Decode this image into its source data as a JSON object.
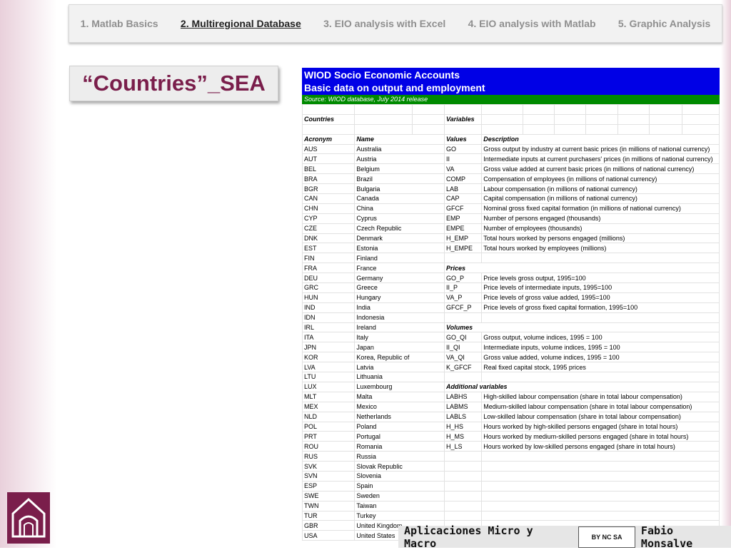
{
  "nav": {
    "items": [
      "1. Matlab Basics",
      "2. Multiregional Database",
      "3. EIO analysis with Excel",
      "4. EIO analysis with Matlab",
      "5. Graphic Analysis"
    ],
    "active_index": 1
  },
  "title": "“Countries”_SEA",
  "sheet": {
    "header_line1": "WIOD Socio Economic Accounts",
    "header_line2": "Basic data on output and employment",
    "source": "Source: WIOD database, July 2014 release",
    "countries_label": "Countries",
    "variables_label": "Variables",
    "col_acronym": "Acronym",
    "col_name": "Name",
    "col_values": "Values",
    "col_description": "Description",
    "rows": [
      [
        "AUS",
        "Australia",
        "GO",
        "Gross output by industry at current basic prices (in millions of national currency)",
        false
      ],
      [
        "AUT",
        "Austria",
        "II",
        "Intermediate inputs at current purchasers' prices (in millions of national currency)",
        false
      ],
      [
        "BEL",
        "Belgium",
        "VA",
        "Gross value added at current basic prices (in millions of national currency)",
        false
      ],
      [
        "BRA",
        "Brazil",
        "COMP",
        "Compensation of employees (in millions of national currency)",
        false
      ],
      [
        "BGR",
        "Bulgaria",
        "LAB",
        "Labour compensation (in millions of national currency)",
        false
      ],
      [
        "CAN",
        "Canada",
        "CAP",
        "Capital compensation (in millions of national currency)",
        false
      ],
      [
        "CHN",
        "China",
        "GFCF",
        "Nominal gross fixed capital formation (in millions of national currency)",
        false
      ],
      [
        "CYP",
        "Cyprus",
        "EMP",
        "Number of persons engaged (thousands)",
        false
      ],
      [
        "CZE",
        "Czech Republic",
        "EMPE",
        "Number of employees (thousands)",
        false
      ],
      [
        "DNK",
        "Denmark",
        "H_EMP",
        "Total hours worked by persons engaged (millions)",
        false
      ],
      [
        "EST",
        "Estonia",
        "H_EMPE",
        "Total hours worked by employees (millions)",
        false
      ],
      [
        "FIN",
        "Finland",
        "",
        "",
        false
      ],
      [
        "FRA",
        "France",
        "Prices",
        "",
        true
      ],
      [
        "DEU",
        "Germany",
        "GO_P",
        "Price levels gross output, 1995=100",
        false
      ],
      [
        "GRC",
        "Greece",
        "II_P",
        "Price levels of intermediate inputs, 1995=100",
        false
      ],
      [
        "HUN",
        "Hungary",
        "VA_P",
        "Price levels of gross value added, 1995=100",
        false
      ],
      [
        "IND",
        "India",
        "GFCF_P",
        "Price levels of gross fixed capital formation, 1995=100",
        false
      ],
      [
        "IDN",
        "Indonesia",
        "",
        "",
        false
      ],
      [
        "IRL",
        "Ireland",
        "Volumes",
        "",
        true
      ],
      [
        "ITA",
        "Italy",
        "GO_QI",
        "Gross output, volume indices, 1995 = 100",
        false
      ],
      [
        "JPN",
        "Japan",
        "II_QI",
        "Intermediate inputs, volume indices, 1995 = 100",
        false
      ],
      [
        "KOR",
        "Korea, Republic of",
        "VA_QI",
        "Gross value added, volume indices, 1995 = 100",
        false
      ],
      [
        "LVA",
        "Latvia",
        "K_GFCF",
        "Real fixed capital stock, 1995 prices",
        false
      ],
      [
        "LTU",
        "Lithuania",
        "",
        "",
        false
      ],
      [
        "LUX",
        "Luxembourg",
        "Additional variables",
        "",
        true
      ],
      [
        "MLT",
        "Malta",
        "LABHS",
        "High-skilled labour compensation (share in total labour compensation)",
        false
      ],
      [
        "MEX",
        "Mexico",
        "LABMS",
        "Medium-skilled labour compensation (share in total labour compensation)",
        false
      ],
      [
        "NLD",
        "Netherlands",
        "LABLS",
        "Low-skilled labour compensation (share in total labour compensation)",
        false
      ],
      [
        "POL",
        "Poland",
        "H_HS",
        "Hours worked by high-skilled persons engaged (share in total hours)",
        false
      ],
      [
        "PRT",
        "Portugal",
        "H_MS",
        "Hours worked by medium-skilled persons engaged (share in total hours)",
        false
      ],
      [
        "ROU",
        "Romania",
        "H_LS",
        "Hours worked by low-skilled persons engaged (share in total hours)",
        false
      ],
      [
        "RUS",
        "Russia",
        "",
        "",
        false
      ],
      [
        "SVK",
        "Slovak Republic",
        "",
        "",
        false
      ],
      [
        "SVN",
        "Slovenia",
        "",
        "",
        false
      ],
      [
        "ESP",
        "Spain",
        "",
        "",
        false
      ],
      [
        "SWE",
        "Sweden",
        "",
        "",
        false
      ],
      [
        "TWN",
        "Taiwan",
        "",
        "",
        false
      ],
      [
        "TUR",
        "Turkey",
        "",
        "",
        false
      ],
      [
        "GBR",
        "United Kingdom",
        "",
        "",
        false
      ],
      [
        "USA",
        "United States",
        "",
        "",
        false
      ]
    ]
  },
  "footer": {
    "course": "Aplicaciones Micro y Macro",
    "license": "BY NC SA",
    "author": "Fabio Monsalve"
  }
}
